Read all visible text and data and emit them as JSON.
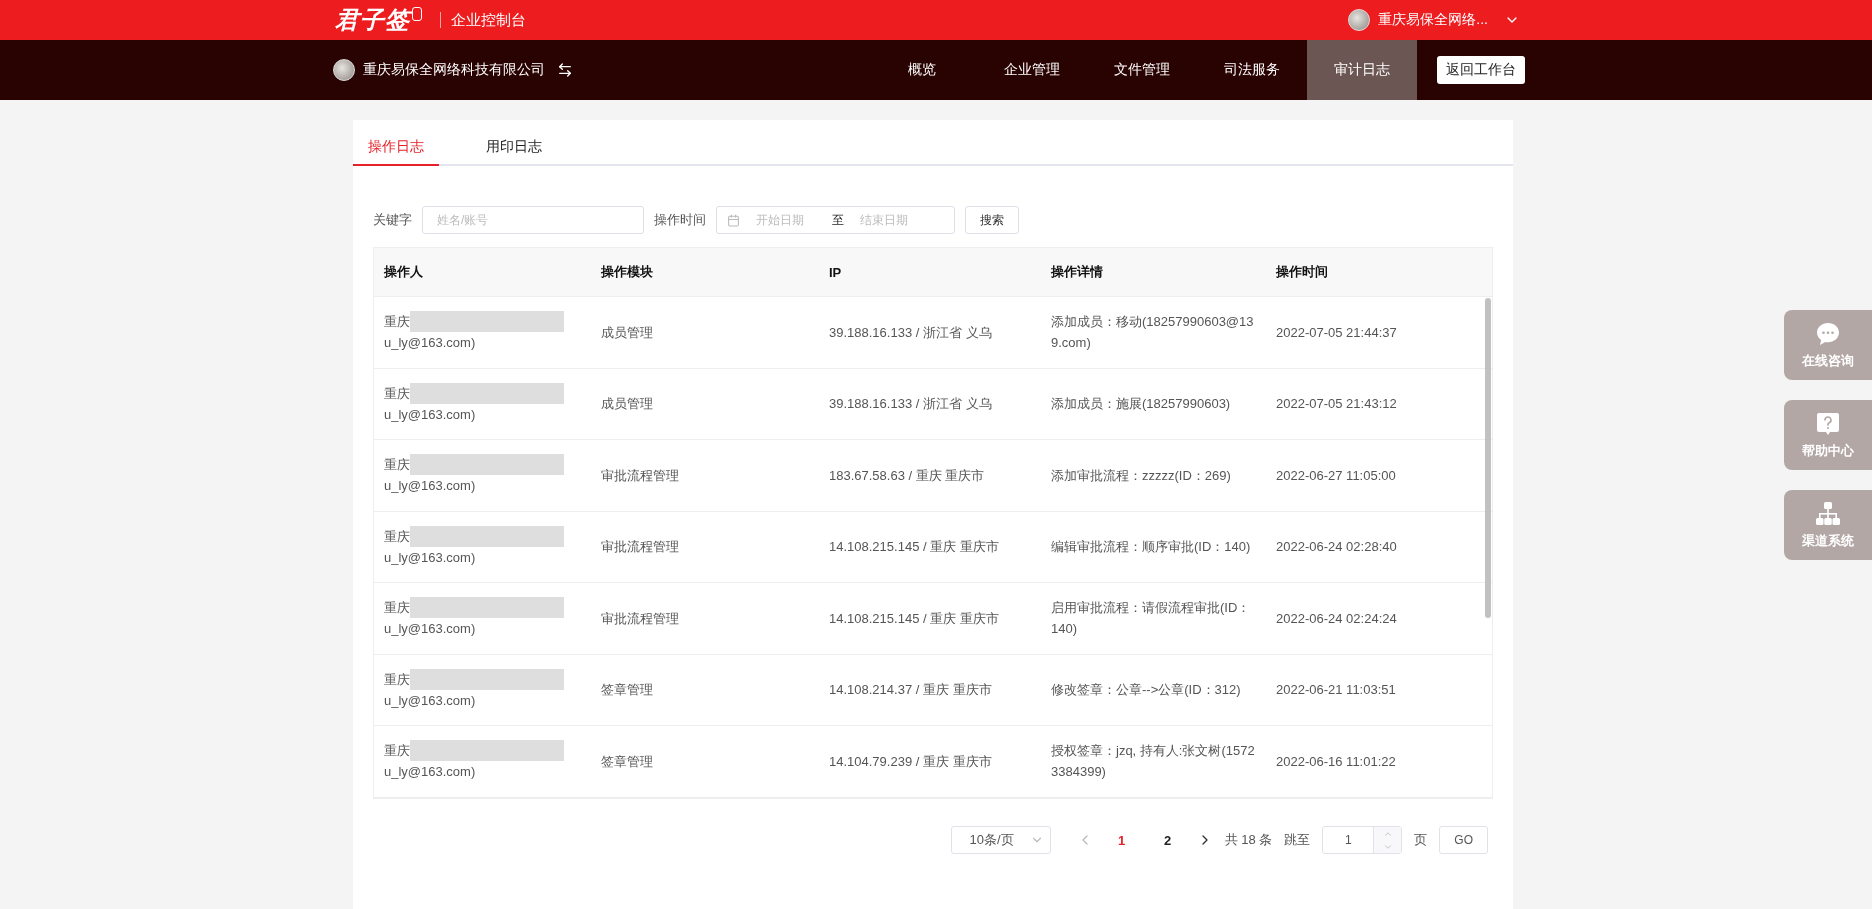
{
  "header": {
    "logo": "君子签",
    "product": "企业控制台",
    "user": "重庆易保全网络..."
  },
  "navbar": {
    "company": "重庆易保全网络科技有限公司",
    "items": [
      {
        "label": "概览",
        "selected": false
      },
      {
        "label": "企业管理",
        "selected": false
      },
      {
        "label": "文件管理",
        "selected": false
      },
      {
        "label": "司法服务",
        "selected": false
      },
      {
        "label": "审计日志",
        "selected": true
      }
    ],
    "back_button": "返回工作台"
  },
  "tabs": [
    {
      "label": "操作日志",
      "selected": true
    },
    {
      "label": "用印日志",
      "selected": false
    }
  ],
  "filters": {
    "keyword_label": "关键字",
    "keyword_placeholder": "姓名/账号",
    "time_label": "操作时间",
    "start_placeholder": "开始日期",
    "separator": "至",
    "end_placeholder": "结束日期",
    "search_button": "搜索"
  },
  "table": {
    "columns": [
      "操作人",
      "操作模块",
      "IP",
      "操作详情",
      "操作时间"
    ],
    "rows": [
      {
        "operator_prefix": "重庆",
        "operator_suffix": "u_ly@163.com)",
        "module": "成员管理",
        "ip": "39.188.16.133 / 浙江省 义乌",
        "detail": "添加成员：移动(18257990603@139.com)",
        "time": "2022-07-05 21:44:37"
      },
      {
        "operator_prefix": "重庆",
        "operator_suffix": "u_ly@163.com)",
        "module": "成员管理",
        "ip": "39.188.16.133 / 浙江省 义乌",
        "detail": "添加成员：施展(18257990603)",
        "time": "2022-07-05 21:43:12"
      },
      {
        "operator_prefix": "重庆",
        "operator_suffix": "u_ly@163.com)",
        "module": "审批流程管理",
        "ip": "183.67.58.63 / 重庆 重庆市",
        "detail": "添加审批流程：zzzzz(ID：269)",
        "time": "2022-06-27 11:05:00"
      },
      {
        "operator_prefix": "重庆",
        "operator_suffix": "u_ly@163.com)",
        "module": "审批流程管理",
        "ip": "14.108.215.145 / 重庆 重庆市",
        "detail": "编辑审批流程：顺序审批(ID：140)",
        "time": "2022-06-24 02:28:40"
      },
      {
        "operator_prefix": "重庆",
        "operator_suffix": "u_ly@163.com)",
        "module": "审批流程管理",
        "ip": "14.108.215.145 / 重庆 重庆市",
        "detail": "启用审批流程：请假流程审批(ID：140)",
        "time": "2022-06-24 02:24:24"
      },
      {
        "operator_prefix": "重庆",
        "operator_suffix": "u_ly@163.com)",
        "module": "签章管理",
        "ip": "14.108.214.37 / 重庆 重庆市",
        "detail": "修改签章：公章-->公章(ID：312)",
        "time": "2022-06-21 11:03:51"
      },
      {
        "operator_prefix": "重庆",
        "operator_suffix": "u_ly@163.com)",
        "module": "签章管理",
        "ip": "14.104.79.239 / 重庆 重庆市",
        "detail": "授权签章：jzq, 持有人:张文树(15723384399)",
        "time": "2022-06-16 11:01:22"
      }
    ]
  },
  "pagination": {
    "page_size": "10条/页",
    "pages": [
      {
        "label": "1",
        "selected": true
      },
      {
        "label": "2",
        "selected": false
      }
    ],
    "total_prefix": "共",
    "total": "18",
    "total_suffix": "条",
    "jump_label": "跳至",
    "jump_value": "1",
    "page_unit": "页",
    "go_button": "GO"
  },
  "side_buttons": [
    {
      "kind": "chat",
      "label": "在线咨询"
    },
    {
      "kind": "help",
      "label": "帮助中心"
    },
    {
      "kind": "channel",
      "label": "渠道系统"
    }
  ]
}
